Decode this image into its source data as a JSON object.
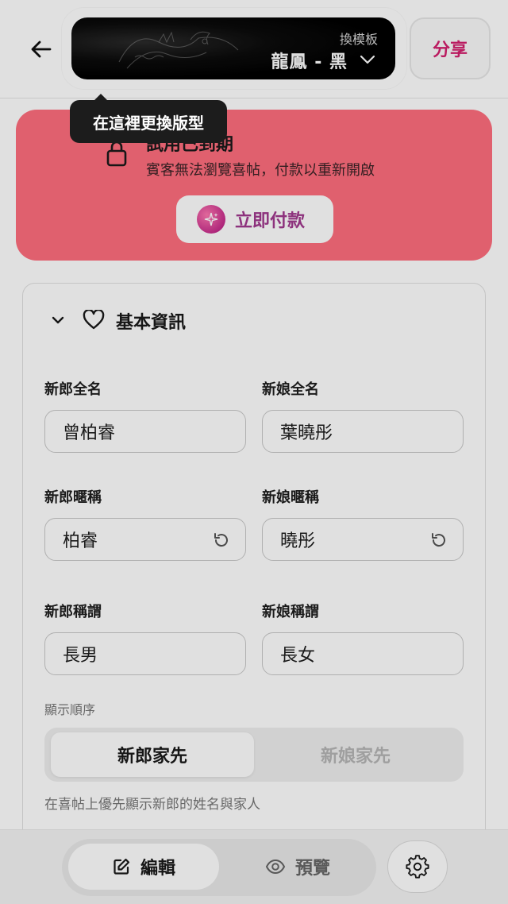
{
  "header": {
    "template_label": "換模板",
    "template_name": "龍鳳 - 黑",
    "share_label": "分享"
  },
  "tooltip": {
    "text": "在這裡更換版型"
  },
  "banner": {
    "title": "試用已到期",
    "subtitle": "賓客無法瀏覽喜帖，付款以重新開啟",
    "pay_label": "立即付款"
  },
  "section": {
    "title": "基本資訊"
  },
  "fields": {
    "groom_name": {
      "label": "新郎全名",
      "value": "曾柏睿"
    },
    "bride_name": {
      "label": "新娘全名",
      "value": "葉曉彤"
    },
    "groom_nickname": {
      "label": "新郎暱稱",
      "value": "柏睿"
    },
    "bride_nickname": {
      "label": "新娘暱稱",
      "value": "曉彤"
    },
    "groom_title": {
      "label": "新郎稱謂",
      "value": "長男"
    },
    "bride_title": {
      "label": "新娘稱謂",
      "value": "長女"
    }
  },
  "display_order": {
    "label": "顯示順序",
    "options": [
      "新郎家先",
      "新娘家先"
    ],
    "selected": "新郎家先",
    "hint": "在喜帖上優先顯示新郎的姓名與家人"
  },
  "bottom_bar": {
    "edit_label": "編輯",
    "preview_label": "預覽",
    "active_mode": "編輯"
  },
  "colors": {
    "accent": "#d41f6e",
    "banner_bg": "#ff6e7e",
    "pay_text": "#a13a8f"
  }
}
